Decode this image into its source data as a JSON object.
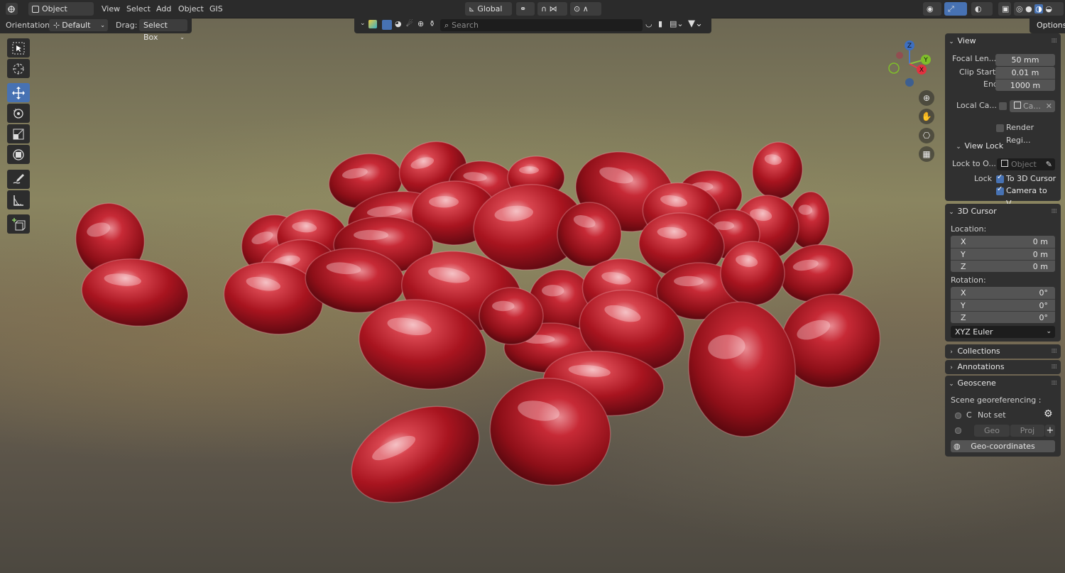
{
  "header": {
    "mode": "Object Mode",
    "menus": [
      "View",
      "Select",
      "Add",
      "Object",
      "GIS"
    ],
    "transform_orientation": "Global",
    "options_label": "Options"
  },
  "tool_options": {
    "orientation_label": "Orientation:",
    "orientation_value": "Default",
    "drag_label": "Drag:",
    "drag_value": "Select Box"
  },
  "outliner": {
    "search_placeholder": "Search"
  },
  "gizmo": {
    "z": "Z",
    "y": "Y",
    "x": "X"
  },
  "npanel": {
    "view": {
      "title": "View",
      "focal_label": "Focal Len...",
      "focal_value": "50 mm",
      "clip_start_label": "Clip Start",
      "clip_start_value": "0.01 m",
      "end_label": "End",
      "end_value": "1000 m",
      "local_camera_label": "Local Ca...",
      "local_camera_value": "Ca...",
      "render_region_label": "Render Regi...",
      "view_lock_title": "View Lock",
      "lock_to_object_label": "Lock to O...",
      "lock_to_object_placeholder": "Object",
      "lock_label": "Lock",
      "lock_3d_cursor_label": "To 3D Cursor",
      "camera_to_view_label": "Camera to V..."
    },
    "cursor": {
      "title": "3D Cursor",
      "location_label": "Location:",
      "loc": [
        {
          "axis": "X",
          "value": "0 m"
        },
        {
          "axis": "Y",
          "value": "0 m"
        },
        {
          "axis": "Z",
          "value": "0 m"
        }
      ],
      "rotation_label": "Rotation:",
      "rot": [
        {
          "axis": "X",
          "value": "0°"
        },
        {
          "axis": "Y",
          "value": "0°"
        },
        {
          "axis": "Z",
          "value": "0°"
        }
      ],
      "rotation_mode": "XYZ Euler"
    },
    "collections_title": "Collections",
    "annotations_title": "Annotations",
    "geoscene": {
      "title": "Geoscene",
      "scene_label": "Scene georeferencing :",
      "crs_letter": "C",
      "crs_value": "Not set",
      "geo_label": "Geo",
      "proj_label": "Proj",
      "geo_coordinates_label": "Geo-coordinates"
    }
  },
  "colors": {
    "accent": "#4772b3",
    "header_bg": "#2b2b2b",
    "panel_bg": "#303030",
    "field_bg": "#545454",
    "seed_red": "#b3202c"
  }
}
